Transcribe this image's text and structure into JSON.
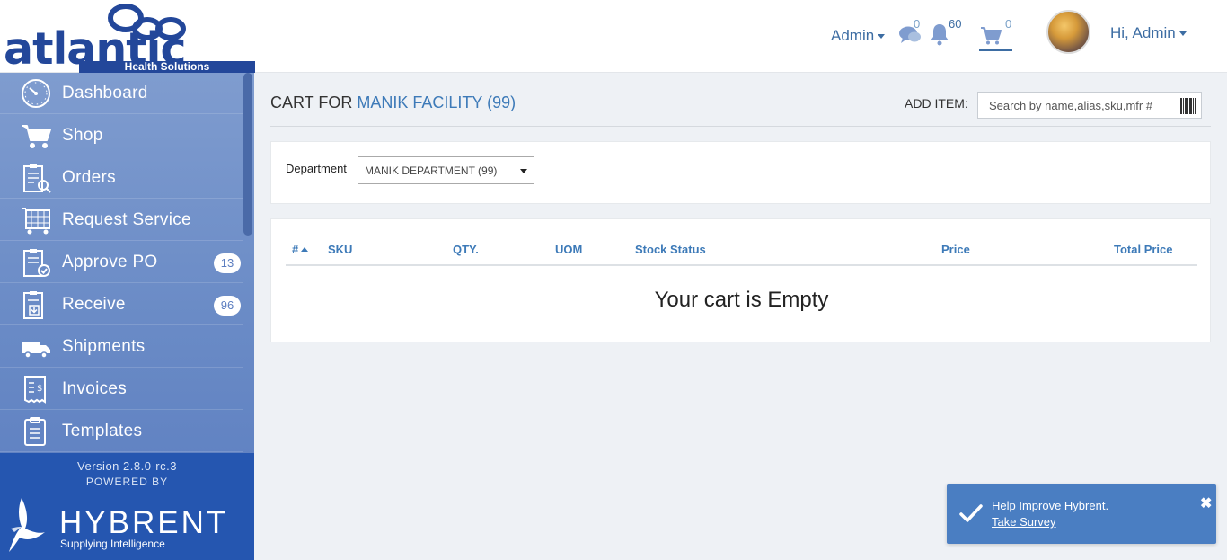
{
  "brand": {
    "logo_word": "atlantic",
    "logo_sub": "Health Solutions"
  },
  "header": {
    "admin_menu": "Admin",
    "messages_count": "0",
    "notifications_count": "60",
    "cart_count": "0",
    "greeting": "Hi, Admin"
  },
  "sidebar": {
    "items": [
      {
        "label": "Dashboard",
        "icon": "dashboard-icon"
      },
      {
        "label": "Shop",
        "icon": "cart-icon"
      },
      {
        "label": "Orders",
        "icon": "orders-icon"
      },
      {
        "label": "Request Service",
        "icon": "request-service-icon"
      },
      {
        "label": "Approve PO",
        "icon": "approve-po-icon",
        "badge": "13"
      },
      {
        "label": "Receive",
        "icon": "receive-icon",
        "badge": "96"
      },
      {
        "label": "Shipments",
        "icon": "truck-icon"
      },
      {
        "label": "Invoices",
        "icon": "invoice-icon"
      },
      {
        "label": "Templates",
        "icon": "templates-icon"
      }
    ],
    "version": "Version 2.8.0-rc.3",
    "powered_by": "POWERED BY",
    "hybrent_word": "HYBRENT",
    "hybrent_tagline": "Supplying Intelligence"
  },
  "main": {
    "title_prefix": "CART FOR",
    "facility": "MANIK FACILITY (99)",
    "add_item_label": "ADD ITEM:",
    "search_placeholder": "Search by name,alias,sku,mfr #",
    "department_label": "Department",
    "department_value": "MANIK DEPARTMENT (99)",
    "columns": [
      "#",
      "SKU",
      "QTY.",
      "UOM",
      "Stock Status",
      "Price",
      "Total Price"
    ],
    "empty_message": "Your cart is Empty"
  },
  "toast": {
    "message": "Help Improve Hybrent.",
    "link": "Take Survey",
    "close": "✖"
  },
  "colors": {
    "brand_navy": "#23479a",
    "link_blue": "#3d7ab8",
    "sidebar_top": "#7f9ccf",
    "sidebar_bottom": "#5b7dc0",
    "sidebar_footer": "#2556b0",
    "toast": "#4a7ec2"
  }
}
